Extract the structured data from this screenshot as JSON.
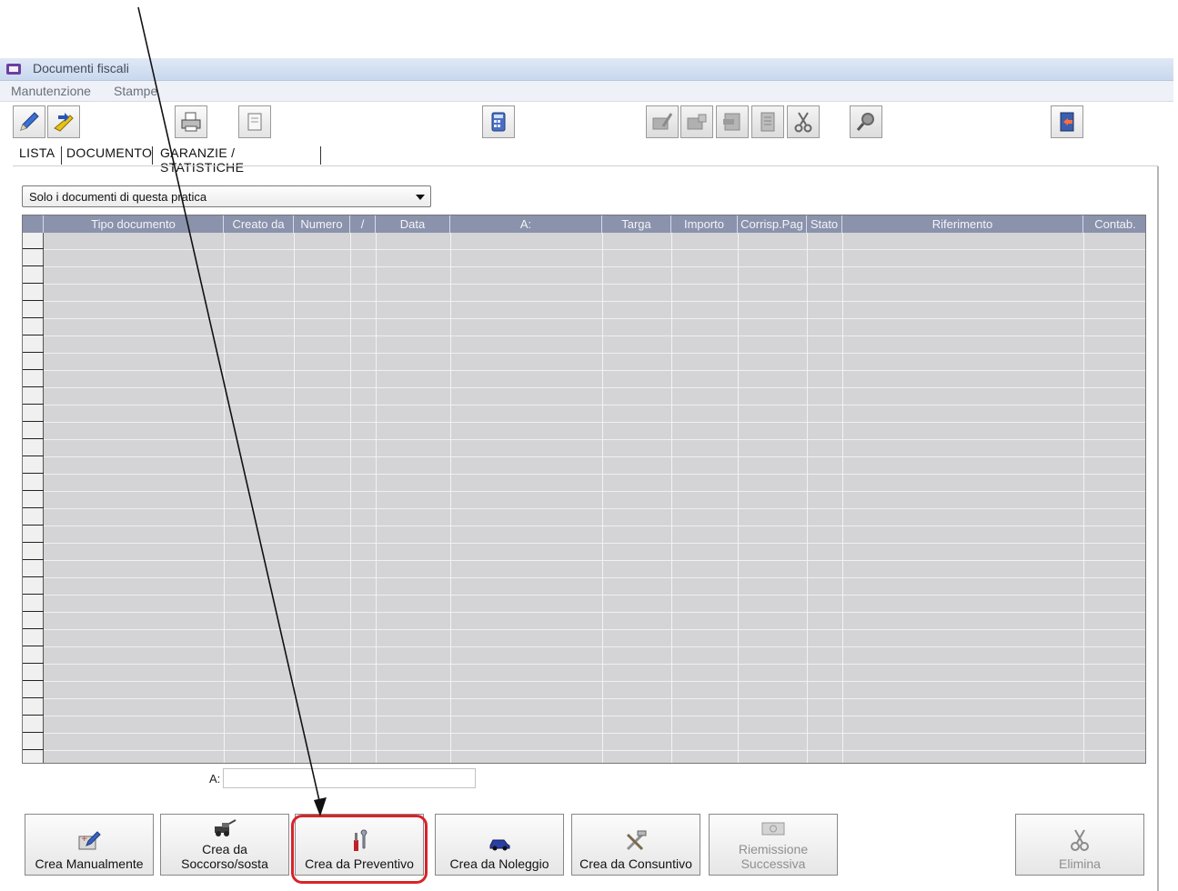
{
  "window": {
    "title": "Documenti fiscali"
  },
  "menu": {
    "items": [
      "Manutenzione",
      "Stampe"
    ]
  },
  "toolbar": {
    "icons": [
      "pencil-icon",
      "arrow-folder-icon",
      "printer-icon",
      "note-icon",
      "calculator-icon",
      "disabled-edit-icon",
      "disabled-card-icon",
      "disabled-page-icon",
      "disabled-doc-icon",
      "scissors-icon",
      "magnifier-icon",
      "exit-door-icon"
    ]
  },
  "tabs": [
    "LISTA",
    "DOCUMENTO",
    "GARANZIE / STATISTICHE"
  ],
  "filter": {
    "selected": "Solo i documenti di questa pratica"
  },
  "grid": {
    "columns": [
      "Tipo documento",
      "Creato da",
      "Numero",
      "/",
      "Data",
      "A:",
      "Targa",
      "Importo",
      "Corrisp.Pag",
      "Stato",
      "Riferimento",
      "Contab."
    ],
    "rows": []
  },
  "a_field": {
    "label": "A:",
    "value": ""
  },
  "buttons": {
    "crea_manualmente": "Crea Manualmente",
    "crea_soccorso": "Crea da\nSoccorso/sosta",
    "crea_preventivo": "Crea da Preventivo",
    "crea_noleggio": "Crea da Noleggio",
    "crea_consuntivo": "Crea da Consuntivo",
    "riemissione": "Riemissione\nSuccessiva",
    "elimina": "Elimina"
  },
  "annotation": {
    "color": "#d8232a"
  }
}
